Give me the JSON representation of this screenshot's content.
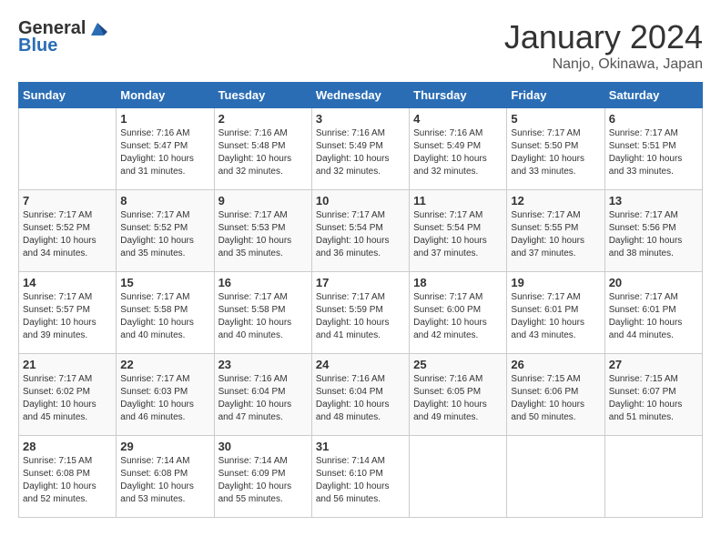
{
  "header": {
    "logo_line1": "General",
    "logo_line2": "Blue",
    "month": "January 2024",
    "location": "Nanjo, Okinawa, Japan"
  },
  "weekdays": [
    "Sunday",
    "Monday",
    "Tuesday",
    "Wednesday",
    "Thursday",
    "Friday",
    "Saturday"
  ],
  "weeks": [
    [
      {
        "day": "",
        "sunrise": "",
        "sunset": "",
        "daylight": ""
      },
      {
        "day": "1",
        "sunrise": "Sunrise: 7:16 AM",
        "sunset": "Sunset: 5:47 PM",
        "daylight": "Daylight: 10 hours and 31 minutes."
      },
      {
        "day": "2",
        "sunrise": "Sunrise: 7:16 AM",
        "sunset": "Sunset: 5:48 PM",
        "daylight": "Daylight: 10 hours and 32 minutes."
      },
      {
        "day": "3",
        "sunrise": "Sunrise: 7:16 AM",
        "sunset": "Sunset: 5:49 PM",
        "daylight": "Daylight: 10 hours and 32 minutes."
      },
      {
        "day": "4",
        "sunrise": "Sunrise: 7:16 AM",
        "sunset": "Sunset: 5:49 PM",
        "daylight": "Daylight: 10 hours and 32 minutes."
      },
      {
        "day": "5",
        "sunrise": "Sunrise: 7:17 AM",
        "sunset": "Sunset: 5:50 PM",
        "daylight": "Daylight: 10 hours and 33 minutes."
      },
      {
        "day": "6",
        "sunrise": "Sunrise: 7:17 AM",
        "sunset": "Sunset: 5:51 PM",
        "daylight": "Daylight: 10 hours and 33 minutes."
      }
    ],
    [
      {
        "day": "7",
        "sunrise": "Sunrise: 7:17 AM",
        "sunset": "Sunset: 5:52 PM",
        "daylight": "Daylight: 10 hours and 34 minutes."
      },
      {
        "day": "8",
        "sunrise": "Sunrise: 7:17 AM",
        "sunset": "Sunset: 5:52 PM",
        "daylight": "Daylight: 10 hours and 35 minutes."
      },
      {
        "day": "9",
        "sunrise": "Sunrise: 7:17 AM",
        "sunset": "Sunset: 5:53 PM",
        "daylight": "Daylight: 10 hours and 35 minutes."
      },
      {
        "day": "10",
        "sunrise": "Sunrise: 7:17 AM",
        "sunset": "Sunset: 5:54 PM",
        "daylight": "Daylight: 10 hours and 36 minutes."
      },
      {
        "day": "11",
        "sunrise": "Sunrise: 7:17 AM",
        "sunset": "Sunset: 5:54 PM",
        "daylight": "Daylight: 10 hours and 37 minutes."
      },
      {
        "day": "12",
        "sunrise": "Sunrise: 7:17 AM",
        "sunset": "Sunset: 5:55 PM",
        "daylight": "Daylight: 10 hours and 37 minutes."
      },
      {
        "day": "13",
        "sunrise": "Sunrise: 7:17 AM",
        "sunset": "Sunset: 5:56 PM",
        "daylight": "Daylight: 10 hours and 38 minutes."
      }
    ],
    [
      {
        "day": "14",
        "sunrise": "Sunrise: 7:17 AM",
        "sunset": "Sunset: 5:57 PM",
        "daylight": "Daylight: 10 hours and 39 minutes."
      },
      {
        "day": "15",
        "sunrise": "Sunrise: 7:17 AM",
        "sunset": "Sunset: 5:58 PM",
        "daylight": "Daylight: 10 hours and 40 minutes."
      },
      {
        "day": "16",
        "sunrise": "Sunrise: 7:17 AM",
        "sunset": "Sunset: 5:58 PM",
        "daylight": "Daylight: 10 hours and 40 minutes."
      },
      {
        "day": "17",
        "sunrise": "Sunrise: 7:17 AM",
        "sunset": "Sunset: 5:59 PM",
        "daylight": "Daylight: 10 hours and 41 minutes."
      },
      {
        "day": "18",
        "sunrise": "Sunrise: 7:17 AM",
        "sunset": "Sunset: 6:00 PM",
        "daylight": "Daylight: 10 hours and 42 minutes."
      },
      {
        "day": "19",
        "sunrise": "Sunrise: 7:17 AM",
        "sunset": "Sunset: 6:01 PM",
        "daylight": "Daylight: 10 hours and 43 minutes."
      },
      {
        "day": "20",
        "sunrise": "Sunrise: 7:17 AM",
        "sunset": "Sunset: 6:01 PM",
        "daylight": "Daylight: 10 hours and 44 minutes."
      }
    ],
    [
      {
        "day": "21",
        "sunrise": "Sunrise: 7:17 AM",
        "sunset": "Sunset: 6:02 PM",
        "daylight": "Daylight: 10 hours and 45 minutes."
      },
      {
        "day": "22",
        "sunrise": "Sunrise: 7:17 AM",
        "sunset": "Sunset: 6:03 PM",
        "daylight": "Daylight: 10 hours and 46 minutes."
      },
      {
        "day": "23",
        "sunrise": "Sunrise: 7:16 AM",
        "sunset": "Sunset: 6:04 PM",
        "daylight": "Daylight: 10 hours and 47 minutes."
      },
      {
        "day": "24",
        "sunrise": "Sunrise: 7:16 AM",
        "sunset": "Sunset: 6:04 PM",
        "daylight": "Daylight: 10 hours and 48 minutes."
      },
      {
        "day": "25",
        "sunrise": "Sunrise: 7:16 AM",
        "sunset": "Sunset: 6:05 PM",
        "daylight": "Daylight: 10 hours and 49 minutes."
      },
      {
        "day": "26",
        "sunrise": "Sunrise: 7:15 AM",
        "sunset": "Sunset: 6:06 PM",
        "daylight": "Daylight: 10 hours and 50 minutes."
      },
      {
        "day": "27",
        "sunrise": "Sunrise: 7:15 AM",
        "sunset": "Sunset: 6:07 PM",
        "daylight": "Daylight: 10 hours and 51 minutes."
      }
    ],
    [
      {
        "day": "28",
        "sunrise": "Sunrise: 7:15 AM",
        "sunset": "Sunset: 6:08 PM",
        "daylight": "Daylight: 10 hours and 52 minutes."
      },
      {
        "day": "29",
        "sunrise": "Sunrise: 7:14 AM",
        "sunset": "Sunset: 6:08 PM",
        "daylight": "Daylight: 10 hours and 53 minutes."
      },
      {
        "day": "30",
        "sunrise": "Sunrise: 7:14 AM",
        "sunset": "Sunset: 6:09 PM",
        "daylight": "Daylight: 10 hours and 55 minutes."
      },
      {
        "day": "31",
        "sunrise": "Sunrise: 7:14 AM",
        "sunset": "Sunset: 6:10 PM",
        "daylight": "Daylight: 10 hours and 56 minutes."
      },
      {
        "day": "",
        "sunrise": "",
        "sunset": "",
        "daylight": ""
      },
      {
        "day": "",
        "sunrise": "",
        "sunset": "",
        "daylight": ""
      },
      {
        "day": "",
        "sunrise": "",
        "sunset": "",
        "daylight": ""
      }
    ]
  ]
}
